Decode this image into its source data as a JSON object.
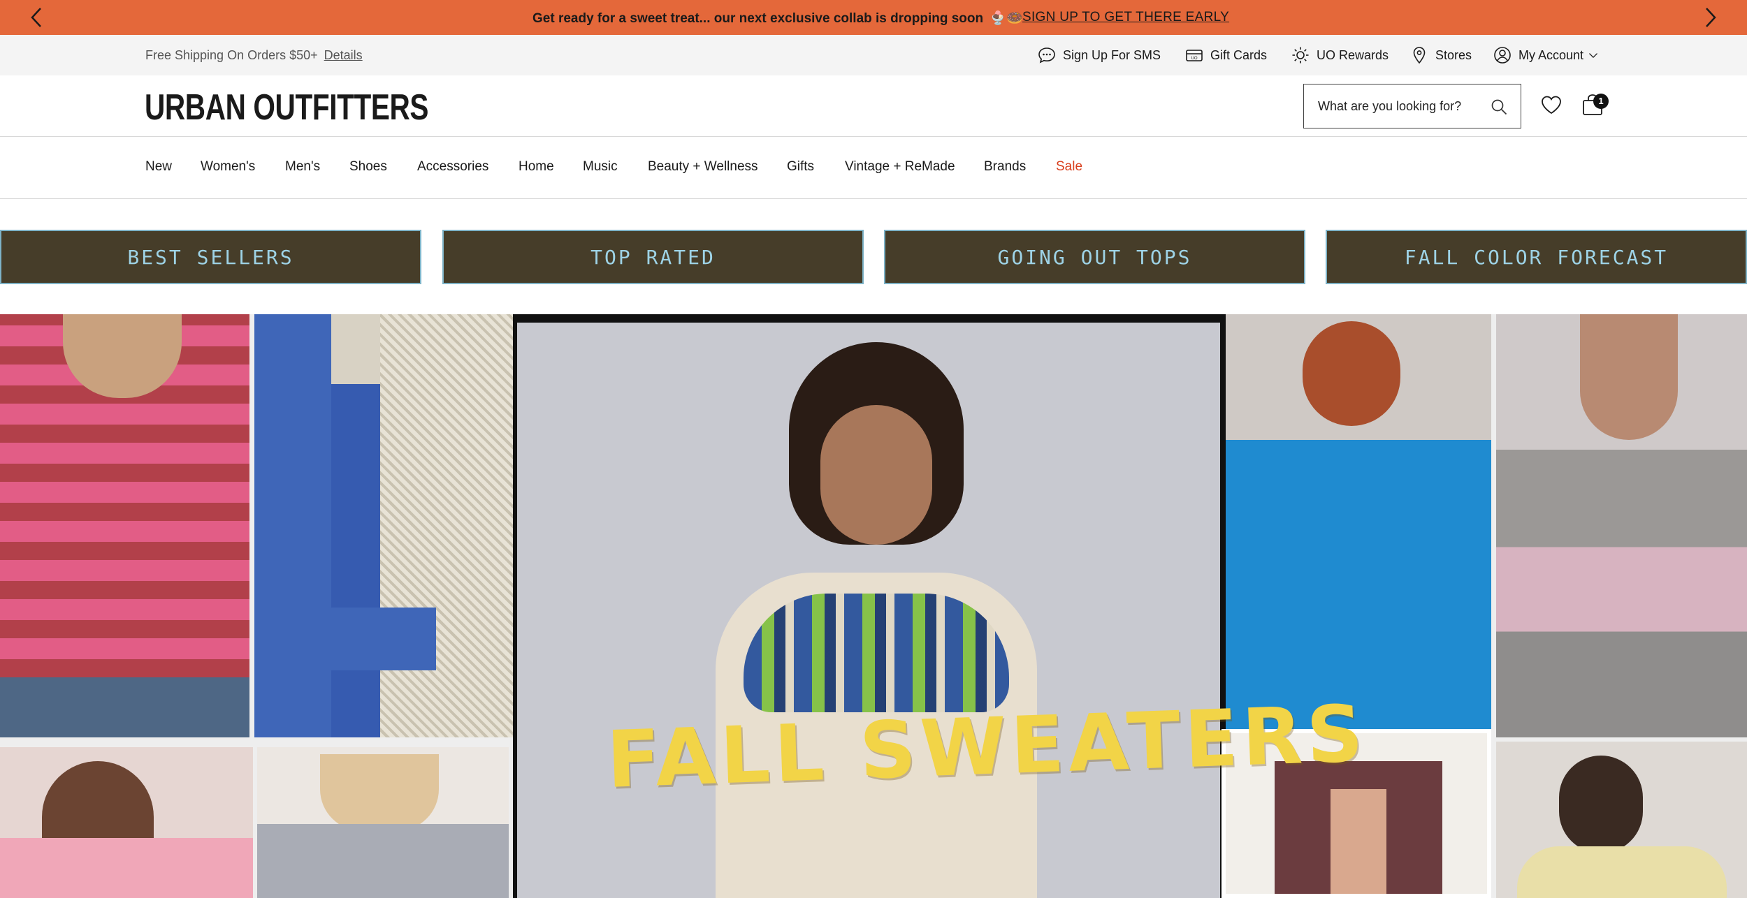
{
  "promo": {
    "message": "Get ready for a sweet treat... our next exclusive collab is dropping soon",
    "emoji": "🍨🍩",
    "cta": "SIGN UP TO GET THERE EARLY"
  },
  "utility": {
    "shipping_text": "Free Shipping On Orders $50+",
    "details_link": "Details",
    "links": {
      "sms": "Sign Up For SMS",
      "gift_cards": "Gift Cards",
      "rewards": "UO Rewards",
      "stores": "Stores",
      "account": "My Account"
    }
  },
  "header": {
    "logo": "URBAN OUTFITTERS",
    "search_placeholder": "What are you looking for?",
    "cart_count": "1"
  },
  "nav": {
    "items": [
      "New",
      "Women's",
      "Men's",
      "Shoes",
      "Accessories",
      "Home",
      "Music",
      "Beauty + Wellness",
      "Gifts",
      "Vintage + ReMade",
      "Brands",
      "Sale"
    ]
  },
  "tiles": [
    "BEST SELLERS",
    "TOP RATED",
    "GOING OUT TOPS",
    "FALL COLOR FORECAST"
  ],
  "hero": {
    "title": "FALL SWEATERS"
  },
  "colors": {
    "promo_bg": "#e4683a",
    "tile_bg": "#463d29",
    "tile_text": "#9ed3e6",
    "sale_red": "#d9401e",
    "hero_title": "#f2d447"
  }
}
